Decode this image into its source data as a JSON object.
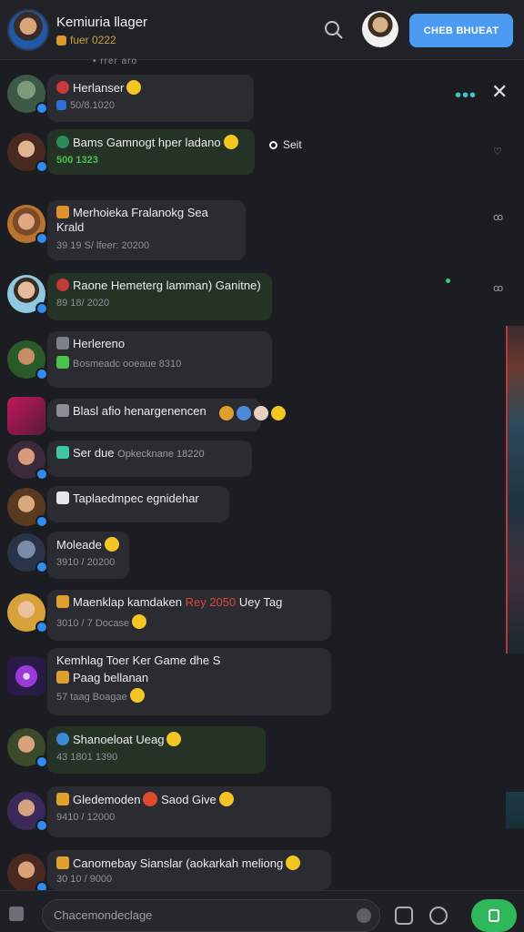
{
  "header": {
    "title": "Kemiuria llager",
    "subtitle": "fuer 0222",
    "button_label": "CHEB BHUEAT",
    "under_text": "•  rrer aro"
  },
  "side": {
    "label": "Seit"
  },
  "messages": [
    {
      "line1": "Herlanser",
      "line2": "50/8.1020"
    },
    {
      "line1": "Bams Gamnogt hper ladano",
      "line2": "500 1323"
    },
    {
      "line1": "Merhoieka Fralanokg Sea Krald",
      "line2": "39 19 S/ lfeer: 20200"
    },
    {
      "line1": "Raone Hemeterg lamman) Ganitne)",
      "line2": "89 18/ 2020"
    },
    {
      "line1": "Herlereno",
      "line2": "Bosmeadc  ooeaue 8310"
    },
    {
      "line1": "Blasl afio henargenencen",
      "line2": ""
    },
    {
      "line1": "Ser due",
      "line2": "Opkecknane 18220"
    },
    {
      "line1": "Taplaedmpec egnidehar",
      "line2": ""
    },
    {
      "line1": "Moleade",
      "line2": "3910 / 20200"
    },
    {
      "line1": "Maenklap kamdaken",
      "line1_red": "Rey 2050",
      "line1_end": "Uey Tag",
      "line2": "3010 / 7 Docase"
    },
    {
      "line1": "Kemhlag Toer Ker Game dhe S",
      "line1b": "Paag bellanan",
      "line2": "57 taag Boagae"
    },
    {
      "line1": "Shanoeloat Ueag",
      "line2": "43 1801 1390"
    },
    {
      "line1": "Gledemoden",
      "line1_end": "Saod Give",
      "line2": "9410 / 12000"
    },
    {
      "line1": "Canomebay Sianslar (aokarkah meliong",
      "line2": "30 10 / 9000"
    }
  ],
  "composer": {
    "placeholder": "Chacemondeclage"
  },
  "colors": {
    "accent_button": "#4c9bf2",
    "send_button": "#2fb85a",
    "subtitle_gold": "#c9a23c",
    "bubble": "#2a2c31",
    "bubble_green": "#253327"
  }
}
